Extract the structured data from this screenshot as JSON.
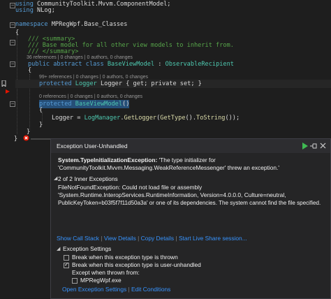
{
  "code": {
    "using1": {
      "kw": "using",
      "ns": " CommunityToolkit.Mvvm.ComponentModel;"
    },
    "using2": {
      "kw": "using",
      "ns": " NLog;"
    },
    "namespace_kw": "namespace",
    "namespace_name": " MPRegWpf.Base_Classes",
    "brace_open": "{",
    "brace_close": "}",
    "summary_open": "/// <summary>",
    "summary_text": "/// Base model for all other view models to inherit from.",
    "summary_close": "/// </summary>",
    "class_lens": "36 references | 0 changes | 0 authors, 0 changes",
    "class_mods": "public abstract class",
    "class_name": "BaseViewModel",
    "class_colon": " : ",
    "base_name": "ObservableRecipient",
    "prop_lens": "99+ references | 0 changes | 0 authors, 0 changes",
    "prop_mods": "protected",
    "prop_type": "Logger",
    "prop_rest": " Logger { get; private set; }",
    "ctor_lens": "0 references | 0 changes | 0 authors, 0 changes",
    "ctor_mods": "protected",
    "ctor_name": "BaseViewModel",
    "ctor_parens": "()",
    "body_open": "{",
    "stmt_lhs": "Logger = ",
    "stmt_cls": "LogManager",
    "stmt_dot": ".",
    "stmt_fn": "GetLogger",
    "stmt_p1": "(",
    "stmt_fn2": "GetType",
    "stmt_p2": "().",
    "stmt_fn3": "ToString",
    "stmt_end": "());",
    "body_close": "}",
    "class_close": "}",
    "ns_close": "}"
  },
  "exception": {
    "title": "Exception User-Unhandled",
    "message_bold": "System.TypeInitializationException:",
    "message_rest": " 'The type initializer for",
    "message_line2": "'CommunityToolkit.Mvvm.Messaging.WeakReferenceMessenger' threw an exception.'",
    "inner_header": "2 of 2 Inner Exceptions",
    "inner_line1": "FileNotFoundException: Could not load file or assembly",
    "inner_line2": "'System.Runtime.InteropServices.RuntimeInformation, Version=4.0.0.0, Culture=neutral,",
    "inner_line3": "PublicKeyToken=b03f5f7f11d50a3a' or one of its dependencies. The system cannot find the file specified.",
    "links": {
      "show_call_stack": "Show Call Stack",
      "view_details": "View Details",
      "copy_details": "Copy Details",
      "live_share": "Start Live Share session...",
      "separator": "|"
    },
    "settings_header": "Exception Settings",
    "opt_thrown": "Break when this exception type is thrown",
    "opt_unhandled": "Break when this exception type is user-unhandled",
    "except_label": "Except when thrown from:",
    "module": "MPRegWpf.exe",
    "open_settings": "Open Exception Settings",
    "edit_conditions": "Edit Conditions",
    "checkbox_thrown": false,
    "checkbox_unhandled": true,
    "checkbox_module": false
  },
  "colors": {
    "keyword": "#569cd6",
    "type": "#4ec9b0",
    "comment": "#57a64a",
    "link": "#3794ff",
    "error": "#e51400"
  },
  "icons": [
    "fold-minus-icon",
    "bookmark-icon",
    "breakpoint-arrow-icon",
    "error-icon",
    "continue-icon",
    "pin-icon",
    "close-icon",
    "collapse-triangle-icon"
  ]
}
